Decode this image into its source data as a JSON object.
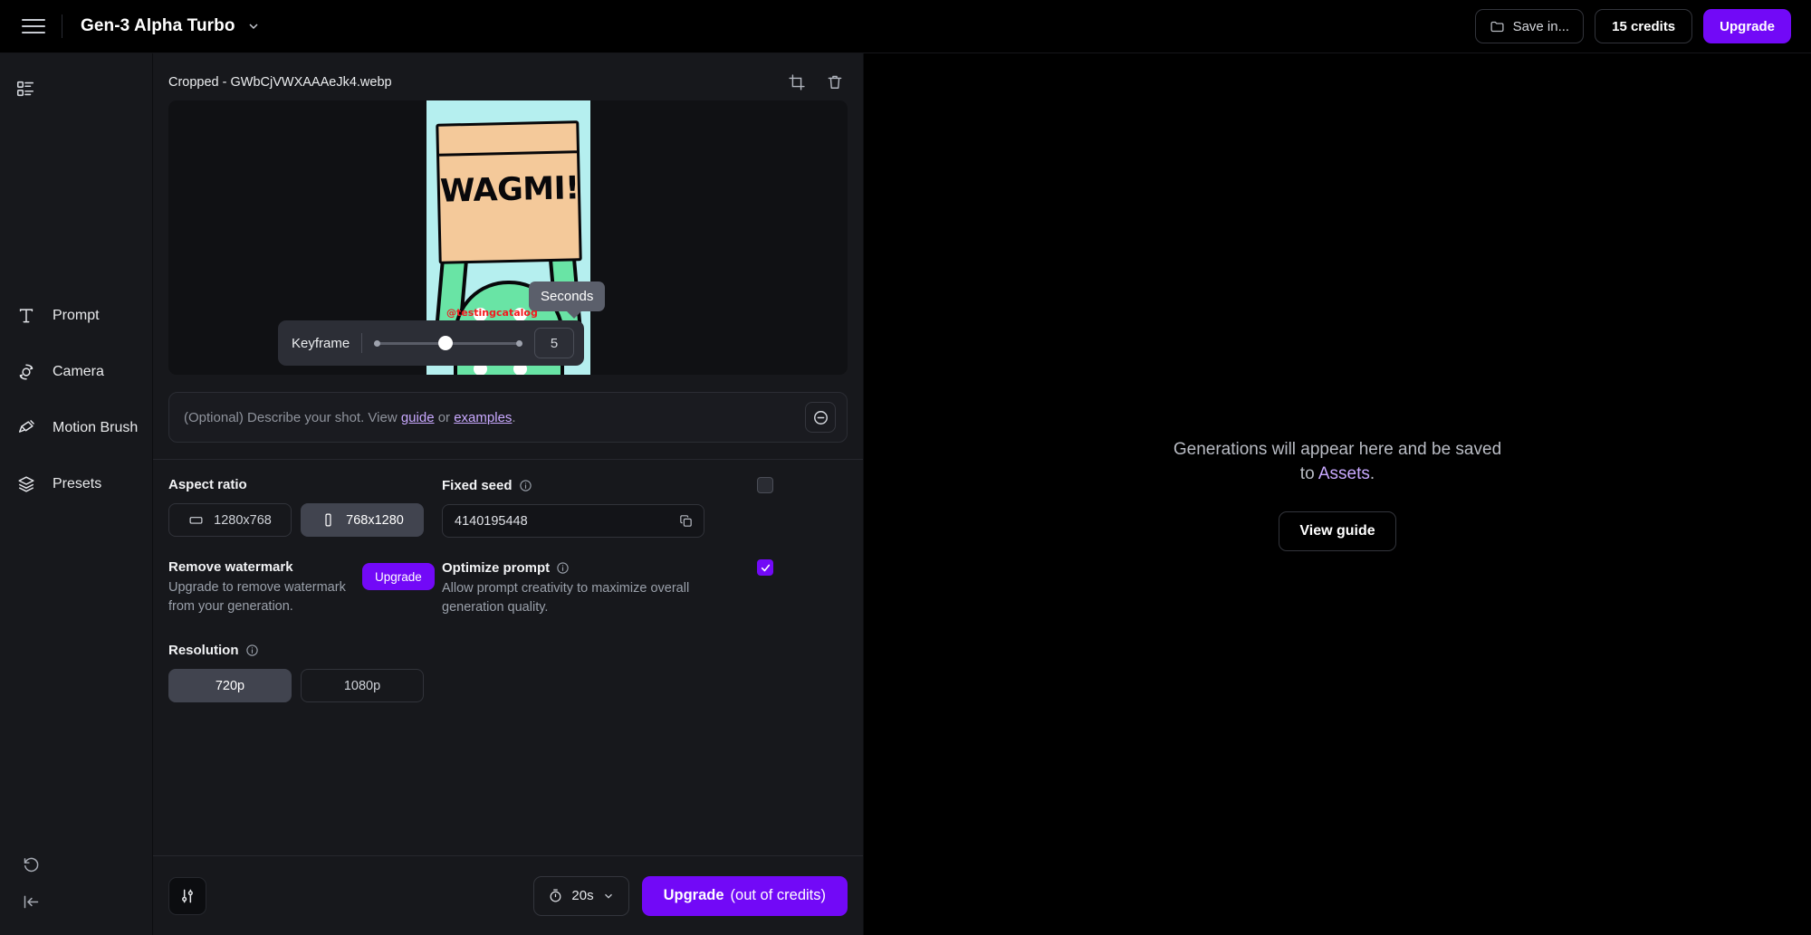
{
  "topbar": {
    "menu_icon": "hamburger-icon",
    "model_name": "Gen-3 Alpha Turbo",
    "model_chevron": "chevron-down-icon",
    "save_in_label": "Save in...",
    "save_in_icon": "folder-icon",
    "credits_label": "15 credits",
    "upgrade_label": "Upgrade"
  },
  "sidebar": {
    "top_icon": "dashboard-icon",
    "items": [
      {
        "label": "Prompt",
        "icon": "text-icon"
      },
      {
        "label": "Camera",
        "icon": "camera-orbit-icon"
      },
      {
        "label": "Motion Brush",
        "icon": "paint-brush-icon"
      },
      {
        "label": "Presets",
        "icon": "layers-icon"
      }
    ],
    "bottom": [
      {
        "icon": "history-undo-icon"
      },
      {
        "icon": "collapse-panel-icon"
      }
    ]
  },
  "asset_card": {
    "filename": "Cropped - GWbCjVWXAAAeJk4.webp",
    "crop_icon": "crop-icon",
    "delete_icon": "trash-icon",
    "image_sign_text": "WAGMI!",
    "watermark": "@testingcatalog"
  },
  "keyframe": {
    "label": "Keyframe",
    "tooltip": "Seconds",
    "value": "5",
    "slider_percent": 48
  },
  "prompt": {
    "placeholder_lead": "(Optional) Describe your shot. View ",
    "link_guide": "guide",
    "placeholder_mid": " or ",
    "link_examples": "examples",
    "placeholder_end": ".",
    "collapse_icon": "circle-minus-icon"
  },
  "aspect_ratio": {
    "label": "Aspect ratio",
    "options": [
      {
        "label": "1280x768",
        "icon": "landscape-icon",
        "selected": false
      },
      {
        "label": "768x1280",
        "icon": "portrait-icon",
        "selected": true
      }
    ]
  },
  "fixed_seed": {
    "label": "Fixed seed",
    "info_icon": "info-icon",
    "checked": false,
    "value": "4140195448",
    "copy_icon": "copy-icon"
  },
  "remove_watermark": {
    "title": "Remove watermark",
    "description": "Upgrade to remove watermark from your generation.",
    "button_label": "Upgrade"
  },
  "optimize_prompt": {
    "title": "Optimize prompt",
    "info_icon": "info-icon",
    "description": "Allow prompt creativity to maximize overall generation quality.",
    "checked": true
  },
  "resolution": {
    "label": "Resolution",
    "info_icon": "info-icon",
    "options": [
      {
        "label": "720p",
        "selected": true
      },
      {
        "label": "1080p",
        "selected": false
      }
    ]
  },
  "bottombar": {
    "tune_icon": "sliders-icon",
    "duration_icon": "timer-icon",
    "duration_label": "20s",
    "duration_chevron": "chevron-down-icon",
    "generate_strong": "Upgrade",
    "generate_rest": "(out of credits)"
  },
  "right_panel": {
    "empty_lead": "Generations will appear here and be saved to ",
    "empty_link": "Assets",
    "empty_end": ".",
    "view_guide_label": "View guide"
  },
  "colors": {
    "accent_purple": "#7209f7",
    "link_purple": "#c9a9ff",
    "panel_bg": "#17181c",
    "canvas_bg": "#000000",
    "watermark_red": "#f4191e"
  }
}
